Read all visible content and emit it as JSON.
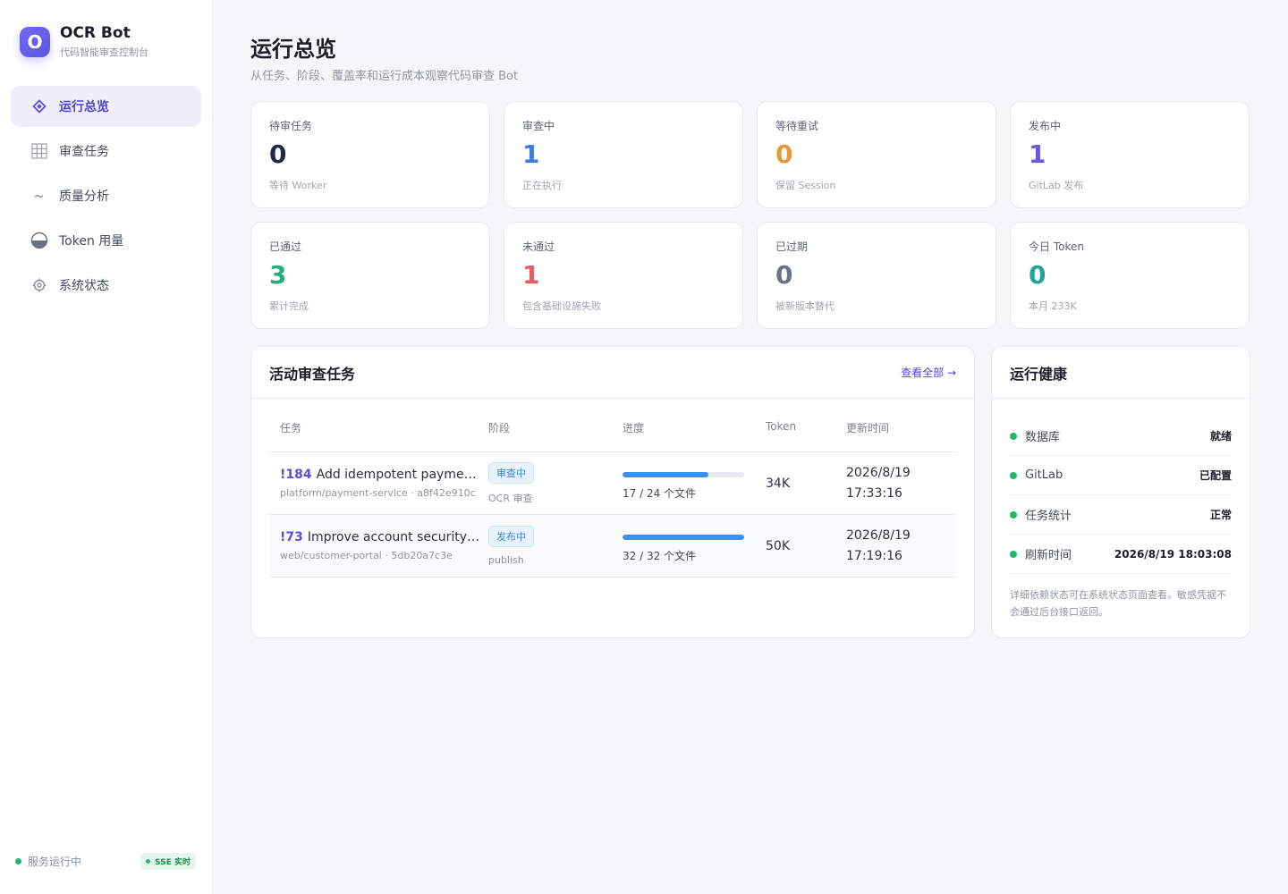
{
  "brand": {
    "logo_letter": "O",
    "title": "OCR Bot",
    "subtitle": "代码智能审查控制台"
  },
  "nav": {
    "items": [
      {
        "label": "运行总览",
        "icon": "diamond-icon",
        "active": true
      },
      {
        "label": "审查任务",
        "icon": "grid-icon",
        "active": false
      },
      {
        "label": "质量分析",
        "icon": "trend-icon",
        "active": false
      },
      {
        "label": "Token 用量",
        "icon": "half-circle-icon",
        "active": false
      },
      {
        "label": "系统状态",
        "icon": "gear-icon",
        "active": false
      }
    ]
  },
  "footer": {
    "status": "服务运行中",
    "sse": "SSE 实时"
  },
  "page": {
    "title": "运行总览",
    "subtitle": "从任务、阶段、覆盖率和运行成本观察代码审查 Bot"
  },
  "stats": [
    {
      "label": "待审任务",
      "value": "0",
      "note": "等待 Worker",
      "color": "#1f2a44"
    },
    {
      "label": "审查中",
      "value": "1",
      "note": "正在执行",
      "color": "#3d7fdb"
    },
    {
      "label": "等待重试",
      "value": "0",
      "note": "保留 Session",
      "color": "#e39a3b"
    },
    {
      "label": "发布中",
      "value": "1",
      "note": "GitLab 发布",
      "color": "#6a58d6"
    },
    {
      "label": "已通过",
      "value": "3",
      "note": "累计完成",
      "color": "#22b07a"
    },
    {
      "label": "未通过",
      "value": "1",
      "note": "包含基础设施失败",
      "color": "#e25c67"
    },
    {
      "label": "已过期",
      "value": "0",
      "note": "被新版本替代",
      "color": "#6b7384"
    },
    {
      "label": "今日 Token",
      "value": "0",
      "note": "本月 233K",
      "color": "#1ea59a"
    }
  ],
  "tasks": {
    "title": "活动审查任务",
    "view_all": "查看全部 →",
    "columns": [
      "任务",
      "阶段",
      "进度",
      "Token",
      "更新时间"
    ],
    "rows": [
      {
        "id": "!184",
        "title": "Add idempotent payment flow",
        "repo": "platform/payment-service · a8f42e910c",
        "stage": "审查中",
        "stage_sub": "OCR 审查",
        "progress": 0.7083,
        "progress_text": "17 / 24 个文件",
        "tokens": "34K",
        "date": "2026/8/19",
        "time": "17:33:16"
      },
      {
        "id": "!73",
        "title": "Improve account security settings",
        "repo": "web/customer-portal · 5db20a7c3e",
        "stage": "发布中",
        "stage_sub": "publish",
        "progress": 1.0,
        "progress_text": "32 / 32 个文件",
        "tokens": "50K",
        "date": "2026/8/19",
        "time": "17:19:16"
      }
    ]
  },
  "health": {
    "title": "运行健康",
    "items": [
      {
        "name": "数据库",
        "value": "就绪"
      },
      {
        "name": "GitLab",
        "value": "已配置"
      },
      {
        "name": "任务统计",
        "value": "正常"
      },
      {
        "name": "刷新时间",
        "value": "2026/8/19 18:03:08"
      }
    ],
    "note": "详细依赖状态可在系统状态页面查看。敏感凭据不会通过后台接口返回。"
  }
}
